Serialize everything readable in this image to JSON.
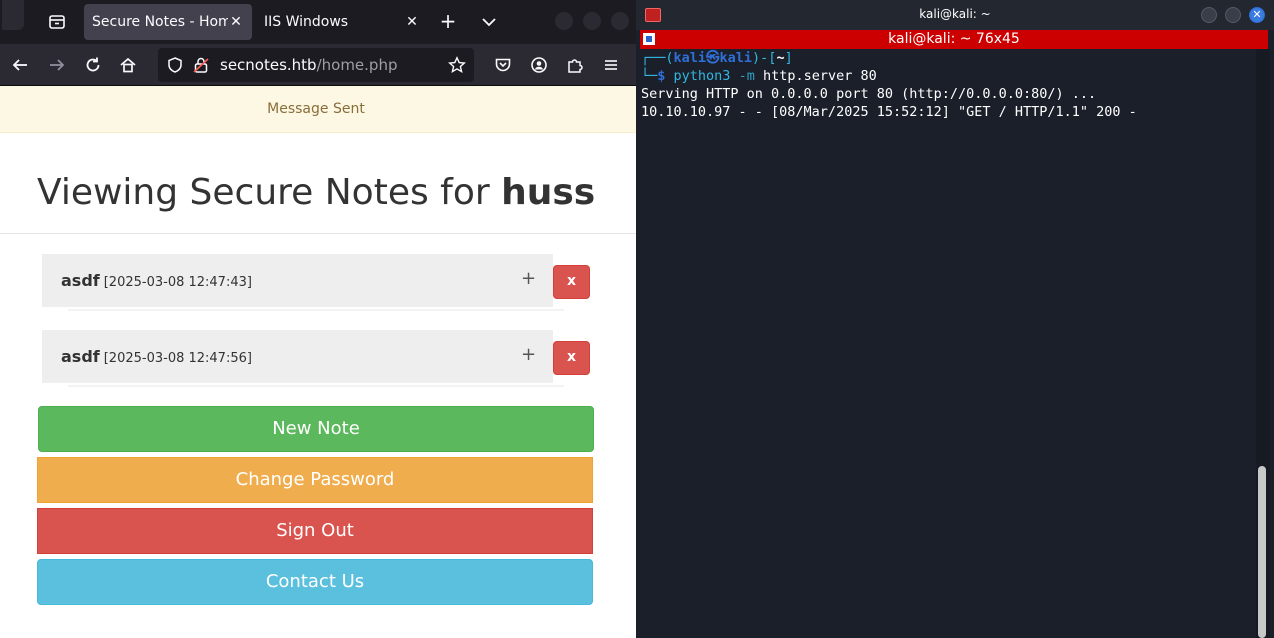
{
  "browser": {
    "tabs": [
      {
        "title": "Secure Notes - Home",
        "active": true
      },
      {
        "title": "IIS Windows",
        "active": false
      }
    ],
    "tab_close": "✕",
    "new_tab": "+",
    "url": {
      "host": "secnotes.htb",
      "path": "/home.php"
    },
    "alert": "Message Sent",
    "heading": {
      "prefix": "Viewing Secure Notes for ",
      "user": "huss"
    },
    "notes": [
      {
        "title": "asdf",
        "timestamp": "[2025-03-08 12:47:43]",
        "expand": "+",
        "delete": "x"
      },
      {
        "title": "asdf",
        "timestamp": "[2025-03-08 12:47:56]",
        "expand": "+",
        "delete": "x"
      }
    ],
    "buttons": {
      "new_note": "New Note",
      "change_password": "Change Password",
      "sign_out": "Sign Out",
      "contact_us": "Contact Us"
    },
    "colors": {
      "success": "#5cb85c",
      "warning": "#f0ad4e",
      "danger": "#d9534f",
      "info": "#5bc0de"
    }
  },
  "terminal": {
    "window_title": "kali@kali: ~",
    "tab_title": "kali@kali: ~ 76x45",
    "close": "✕",
    "prompt": {
      "line1_a": "┌──(",
      "user_host": "kali㉿kali",
      "line1_b": ")-[",
      "cwd": "~",
      "line1_c": "]",
      "line2_a": "└─",
      "dollar": "$ ",
      "cmd": "python3",
      "flag": " -m",
      "args": " http.server 80"
    },
    "output": [
      "Serving HTTP on 0.0.0.0 port 80 (http://0.0.0.0:80/) ...",
      "10.10.10.97 - - [08/Mar/2025 15:52:12] \"GET / HTTP/1.1\" 200 -"
    ]
  }
}
